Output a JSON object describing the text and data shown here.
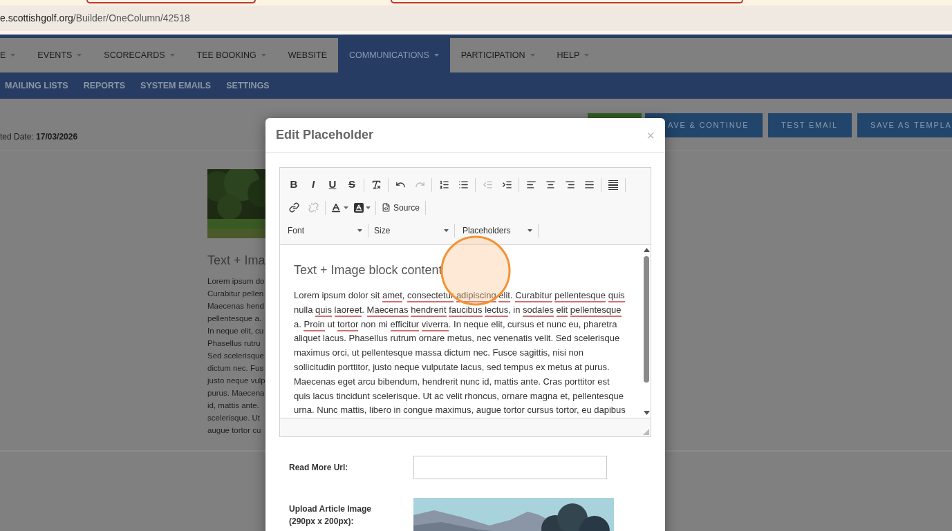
{
  "browser": {
    "url_domain": "e.scottishgolf.org",
    "url_path": "/Builder/OneColumn/42518"
  },
  "main_nav": [
    {
      "label": "E",
      "dropdown": true,
      "selected": false
    },
    {
      "label": "EVENTS",
      "dropdown": true,
      "selected": false
    },
    {
      "label": "SCORECARDS",
      "dropdown": true,
      "selected": false
    },
    {
      "label": "TEE BOOKING",
      "dropdown": true,
      "selected": false
    },
    {
      "label": "WEBSITE",
      "dropdown": false,
      "selected": false
    },
    {
      "label": "COMMUNICATIONS",
      "dropdown": true,
      "selected": true
    },
    {
      "label": "PARTICIPATION",
      "dropdown": true,
      "selected": false
    },
    {
      "label": "HELP",
      "dropdown": true,
      "selected": false
    }
  ],
  "sub_nav": [
    "MAILING LISTS",
    "REPORTS",
    "SYSTEM EMAILS",
    "SETTINGS"
  ],
  "actions": [
    {
      "kind": "green"
    },
    {
      "kind": "blue",
      "label": "AVE & CONTINUE"
    },
    {
      "kind": "blue",
      "label": "TEST EMAIL"
    },
    {
      "kind": "blue",
      "label": "SAVE AS TEMPLA"
    }
  ],
  "date": {
    "label": "ted Date:",
    "value": "17/03/2026"
  },
  "preview": {
    "heading": "Text + Ima",
    "lines": [
      "Lorem ipsum do",
      "Curabitur pellen",
      "Maecenas hend",
      "pellentesque a.",
      "In neque elit, cu",
      "Phasellus rutru",
      "Sed scelerisque",
      "dictum nec. Fus",
      "justo neque vulp",
      "purus. Maecena",
      "id, mattis ante.",
      "scelerisque. Ut",
      "augue tortor cu"
    ]
  },
  "modal": {
    "title": "Edit Placeholder",
    "close": "×",
    "toolbar": [
      [
        [
          {
            "kind": "bold",
            "label": "B",
            "disabled": false
          },
          {
            "kind": "italic",
            "label": "I",
            "disabled": false
          },
          {
            "kind": "underline",
            "label": "U",
            "disabled": false
          },
          {
            "kind": "strike",
            "label": "S",
            "disabled": false
          }
        ],
        [
          {
            "kind": "clear-format",
            "disabled": false
          }
        ],
        [
          {
            "kind": "undo",
            "disabled": false
          },
          {
            "kind": "redo",
            "disabled": true
          }
        ],
        [
          {
            "kind": "ordered-list",
            "disabled": false
          },
          {
            "kind": "bullet-list",
            "disabled": false
          }
        ],
        [
          {
            "kind": "outdent",
            "disabled": true
          },
          {
            "kind": "indent",
            "disabled": false
          }
        ],
        [
          {
            "kind": "align-left",
            "disabled": false
          },
          {
            "kind": "align-center",
            "disabled": false
          },
          {
            "kind": "align-right",
            "disabled": false
          },
          {
            "kind": "align-justify",
            "disabled": false
          }
        ],
        [
          {
            "kind": "horizontal-rule",
            "disabled": false
          }
        ]
      ],
      [
        [
          {
            "kind": "link",
            "disabled": false
          },
          {
            "kind": "unlink",
            "disabled": true
          }
        ],
        [
          {
            "kind": "text-color",
            "disabled": false
          },
          {
            "kind": "bg-color",
            "disabled": false
          }
        ],
        [
          {
            "kind": "source",
            "label": "Source",
            "disabled": false
          }
        ]
      ]
    ],
    "combos": [
      "Font",
      "Size",
      "Placeholders"
    ],
    "content": {
      "heading": "Text + Image block content",
      "paragraph": [
        {
          "text": "Lorem ipsum dolor sit ",
          "misspelled": false
        },
        {
          "text": "amet",
          "misspelled": true
        },
        {
          "text": ", ",
          "misspelled": false
        },
        {
          "text": "consectetur ",
          "misspelled": true
        },
        {
          "text": "adipiscing ",
          "misspelled": true
        },
        {
          "text": "elit",
          "misspelled": true
        },
        {
          "text": ". ",
          "misspelled": false
        },
        {
          "text": "Curabitur ",
          "misspelled": true
        },
        {
          "text": "pellentesque ",
          "misspelled": true
        },
        {
          "text": "quis",
          "misspelled": true
        },
        {
          "text": " nulla ",
          "misspelled": false
        },
        {
          "text": "quis ",
          "misspelled": true
        },
        {
          "text": "laoreet",
          "misspelled": true
        },
        {
          "text": ". ",
          "misspelled": false
        },
        {
          "text": "Maecenas ",
          "misspelled": true
        },
        {
          "text": "hendrerit ",
          "misspelled": true
        },
        {
          "text": "faucibus ",
          "misspelled": true
        },
        {
          "text": "lectus",
          "misspelled": true
        },
        {
          "text": ", in ",
          "misspelled": false
        },
        {
          "text": "sodales ",
          "misspelled": true
        },
        {
          "text": "elit ",
          "misspelled": true
        },
        {
          "text": "pellentesque",
          "misspelled": true
        },
        {
          "text": " a. ",
          "misspelled": false
        },
        {
          "text": "Proin",
          "misspelled": true
        },
        {
          "text": " ut ",
          "misspelled": false
        },
        {
          "text": "tortor",
          "misspelled": true
        },
        {
          "text": " non mi ",
          "misspelled": false
        },
        {
          "text": "efficitur ",
          "misspelled": true
        },
        {
          "text": "viverra",
          "misspelled": true
        },
        {
          "text": ". In neque elit, cursus et nunc eu, pharetra aliquet lacus. Phasellus rutrum ornare metus, nec venenatis velit. Sed scelerisque maximus orci, ut pellentesque massa dictum nec. Fusce sagittis, nisi non sollicitudin porttitor, justo neque vulputate lacus, sed tempus ex metus at purus. Maecenas eget arcu bibendum, hendrerit nunc id, mattis ante. Cras porttitor est quis lacus tincidunt scelerisque. Ut ac velit rhoncus, ornare magna et, pellentesque urna. Nunc mattis, libero in congue maximus, augue tortor cursus tortor, eu dapibus",
          "misspelled": false
        }
      ]
    },
    "fields": [
      {
        "kind": "text",
        "label": "Read More Url:"
      },
      {
        "label": "Upload Article Image (290px x 200px):"
      }
    ]
  }
}
